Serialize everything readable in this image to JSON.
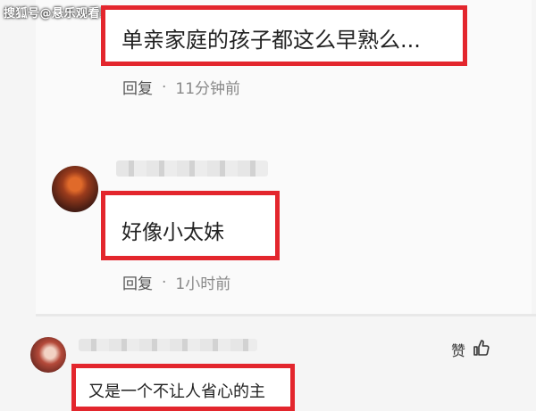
{
  "watermark": "搜狐号@悬乐观看家",
  "comments": [
    {
      "text": "单亲家庭的孩子都这么早熟么...",
      "reply_label": "回复",
      "separator": "·",
      "time": "11分钟前"
    },
    {
      "text": "好像小太妹",
      "reply_label": "回复",
      "separator": "·",
      "time": "1小时前"
    },
    {
      "text": "又是一个不让人省心的主",
      "like_label": "赞"
    }
  ],
  "colors": {
    "highlight": "#e3262d",
    "meta": "#888888"
  }
}
